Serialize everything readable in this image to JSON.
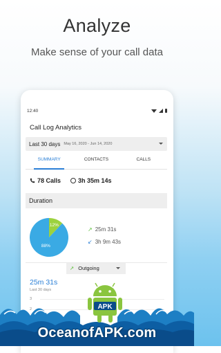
{
  "hero": {
    "title": "Analyze",
    "subtitle": "Make sense of your call data"
  },
  "status": {
    "time": "12:40"
  },
  "app": {
    "title": "Call Log Analytics"
  },
  "range": {
    "label": "Last 30 days",
    "dates": "May 16, 2020 - Jun 14, 2020"
  },
  "tabs": [
    "SUMMARY",
    "CONTACTS",
    "CALLS"
  ],
  "stats": {
    "calls": "78 Calls",
    "duration": "3h 35m 14s"
  },
  "section": {
    "title": "Duration"
  },
  "pie": {
    "slices": [
      {
        "label": "12%",
        "value": 12,
        "color": "#9cd23e"
      },
      {
        "label": "88%",
        "value": 88,
        "color": "#3aaae4"
      }
    ]
  },
  "legend": {
    "outgoing": {
      "value": "25m 31s",
      "color": "#5cbf3a"
    },
    "incoming": {
      "value": "3h 9m 43s",
      "color": "#2a7fd6"
    }
  },
  "dropdown": {
    "selected": "Outgoing"
  },
  "chart": {
    "value": "25m 31s",
    "period": "Last 30 days",
    "ticks": [
      "3",
      "2"
    ]
  },
  "watermark": {
    "text": "OceanofAPK.com",
    "logo_text": "APK"
  }
}
